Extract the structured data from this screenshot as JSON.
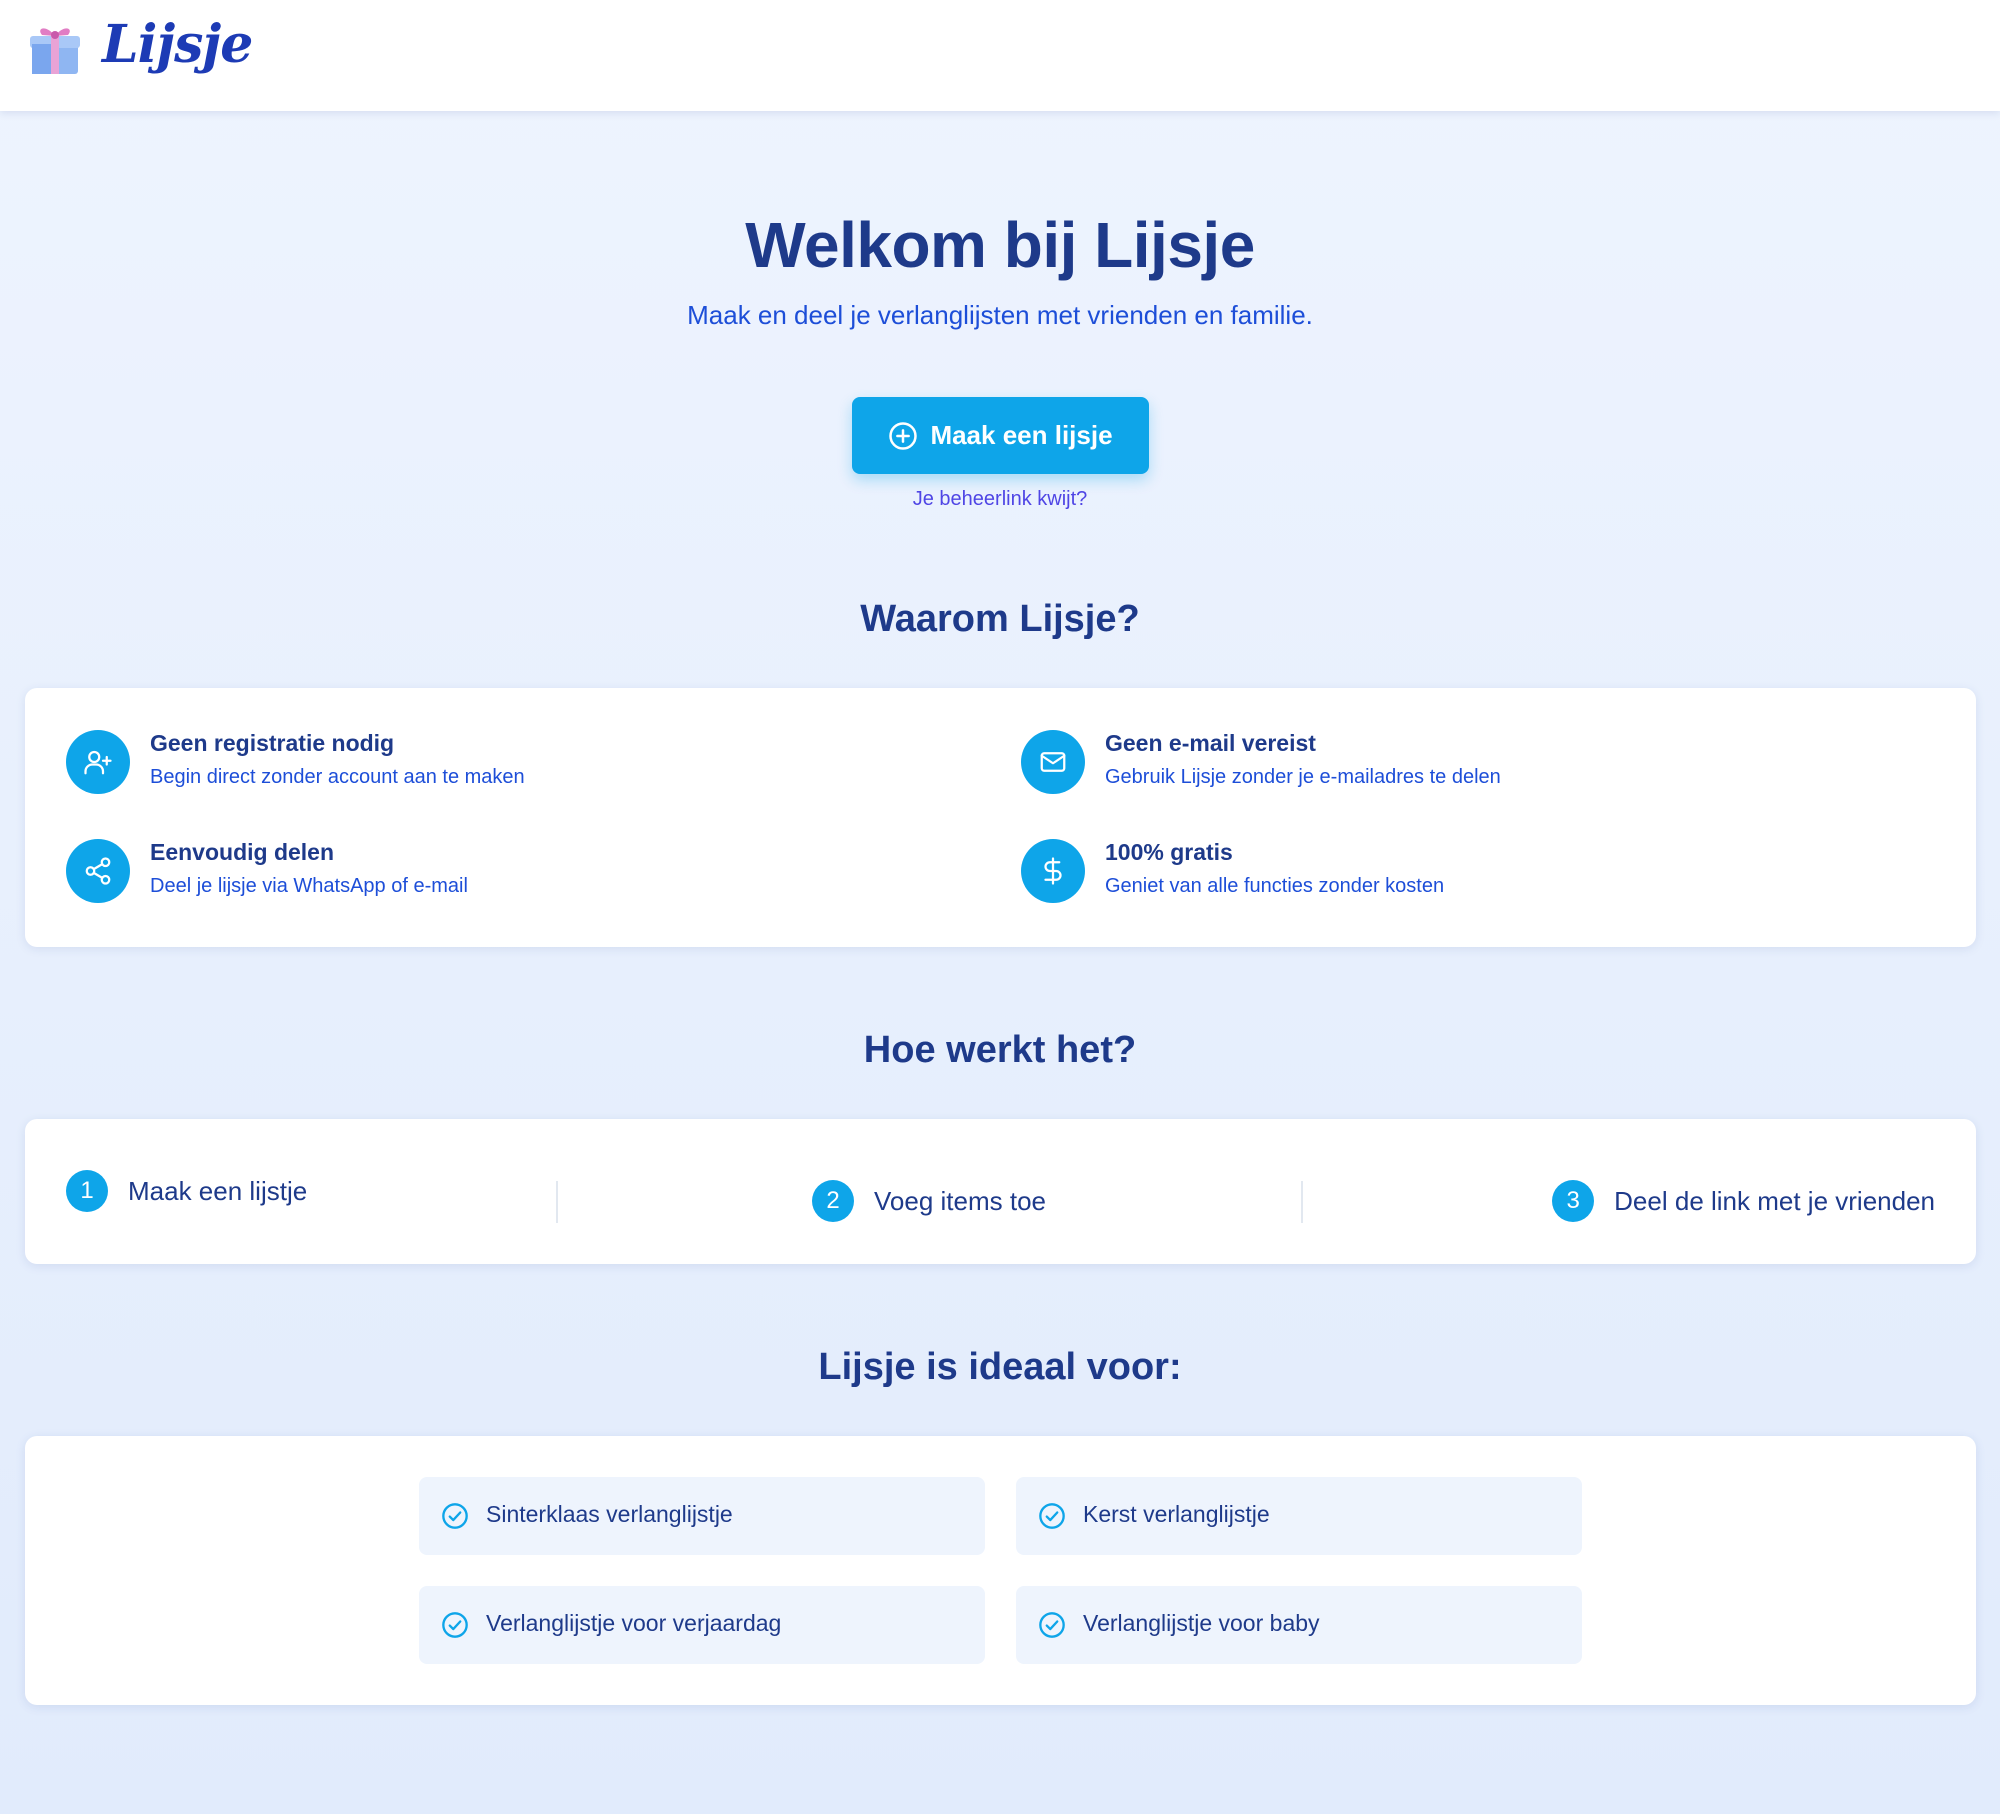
{
  "header": {
    "brand": "Lijsje"
  },
  "hero": {
    "title": "Welkom bij Lijsje",
    "subtitle": "Maak en deel je verlanglijsten met vrienden en familie.",
    "cta_label": "Maak een lijsje",
    "lost_link": "Je beheerlink kwijt?"
  },
  "why": {
    "title": "Waarom Lijsje?",
    "features": [
      {
        "title": "Geen registratie nodig",
        "desc": "Begin direct zonder account aan te maken",
        "icon": "user-plus-icon"
      },
      {
        "title": "Geen e-mail vereist",
        "desc": "Gebruik Lijsje zonder je e-mailadres te delen",
        "icon": "mail-icon"
      },
      {
        "title": "Eenvoudig delen",
        "desc": "Deel je lijsje via WhatsApp of e-mail",
        "icon": "share-icon"
      },
      {
        "title": "100% gratis",
        "desc": "Geniet van alle functies zonder kosten",
        "icon": "dollar-icon"
      }
    ]
  },
  "how": {
    "title": "Hoe werkt het?",
    "steps": [
      {
        "num": "1",
        "label": "Maak een lijstje"
      },
      {
        "num": "2",
        "label": "Voeg items toe"
      },
      {
        "num": "3",
        "label": "Deel de link met je vrienden"
      }
    ]
  },
  "ideal": {
    "title": "Lijsje is ideaal voor:",
    "items": [
      "Sinterklaas verlanglijstje",
      "Kerst verlanglijstje",
      "Verlanglijstje voor verjaardag",
      "Verlanglijstje voor baby"
    ]
  },
  "colors": {
    "accent": "#0ea5e9",
    "primary_text": "#1e3a8a",
    "link": "#4f46e5"
  }
}
